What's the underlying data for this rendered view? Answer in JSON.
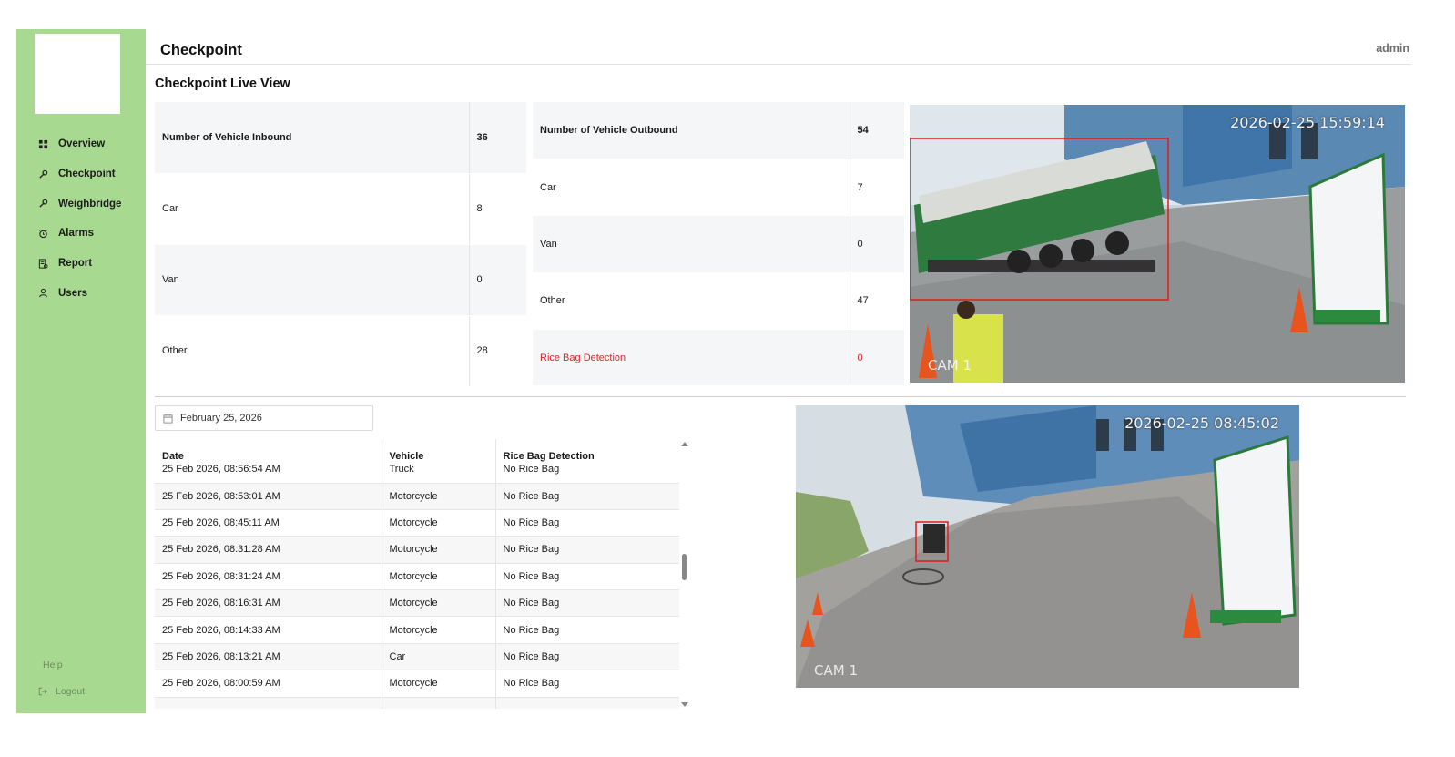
{
  "app": {
    "title": "Checkpoint",
    "user": "admin"
  },
  "sidebar": {
    "items": [
      {
        "label": "Overview",
        "icon": "grid-icon"
      },
      {
        "label": "Checkpoint",
        "icon": "wrench-icon"
      },
      {
        "label": "Weighbridge",
        "icon": "wrench-icon"
      },
      {
        "label": "Alarms",
        "icon": "alarm-clock-icon"
      },
      {
        "label": "Report",
        "icon": "report-icon"
      },
      {
        "label": "Users",
        "icon": "user-icon"
      }
    ],
    "help": "Help",
    "logout": "Logout"
  },
  "page": {
    "title": "Checkpoint Live View"
  },
  "inbound": {
    "rows": [
      {
        "label": "Number of Vehicle Inbound",
        "value": "36"
      },
      {
        "label": "Car",
        "value": "8"
      },
      {
        "label": "Van",
        "value": "0"
      },
      {
        "label": "Other",
        "value": "28"
      }
    ]
  },
  "outbound": {
    "rows": [
      {
        "label": "Number of Vehicle Outbound",
        "value": "54"
      },
      {
        "label": "Car",
        "value": "7"
      },
      {
        "label": "Van",
        "value": "0"
      },
      {
        "label": "Other",
        "value": "47"
      },
      {
        "label": "Rice Bag Detection",
        "value": "0"
      }
    ]
  },
  "cameras": [
    {
      "timestamp": "2026-02-25 15:59:14",
      "label": "CAM 1"
    },
    {
      "timestamp": "2026-02-25 08:45:02",
      "label": "CAM 1"
    }
  ],
  "filter": {
    "date": "February 25, 2026"
  },
  "log": {
    "columns": [
      "Date",
      "Vehicle",
      "Rice Bag Detection"
    ],
    "rows": [
      [
        "25 Feb 2026, 08:56:54 AM",
        "Truck",
        "No Rice Bag"
      ],
      [
        "25 Feb 2026, 08:53:01 AM",
        "Motorcycle",
        "No Rice Bag"
      ],
      [
        "25 Feb 2026, 08:45:11 AM",
        "Motorcycle",
        "No Rice Bag"
      ],
      [
        "25 Feb 2026, 08:31:28 AM",
        "Motorcycle",
        "No Rice Bag"
      ],
      [
        "25 Feb 2026, 08:31:24 AM",
        "Motorcycle",
        "No Rice Bag"
      ],
      [
        "25 Feb 2026, 08:16:31 AM",
        "Motorcycle",
        "No Rice Bag"
      ],
      [
        "25 Feb 2026, 08:14:33 AM",
        "Motorcycle",
        "No Rice Bag"
      ],
      [
        "25 Feb 2026, 08:13:21 AM",
        "Car",
        "No Rice Bag"
      ],
      [
        "25 Feb 2026, 08:00:59 AM",
        "Motorcycle",
        "No Rice Bag"
      ]
    ]
  },
  "colors": {
    "sidebar": "#a8d991",
    "alert": "#d42a2a",
    "detection_box": "#e01b1b"
  }
}
